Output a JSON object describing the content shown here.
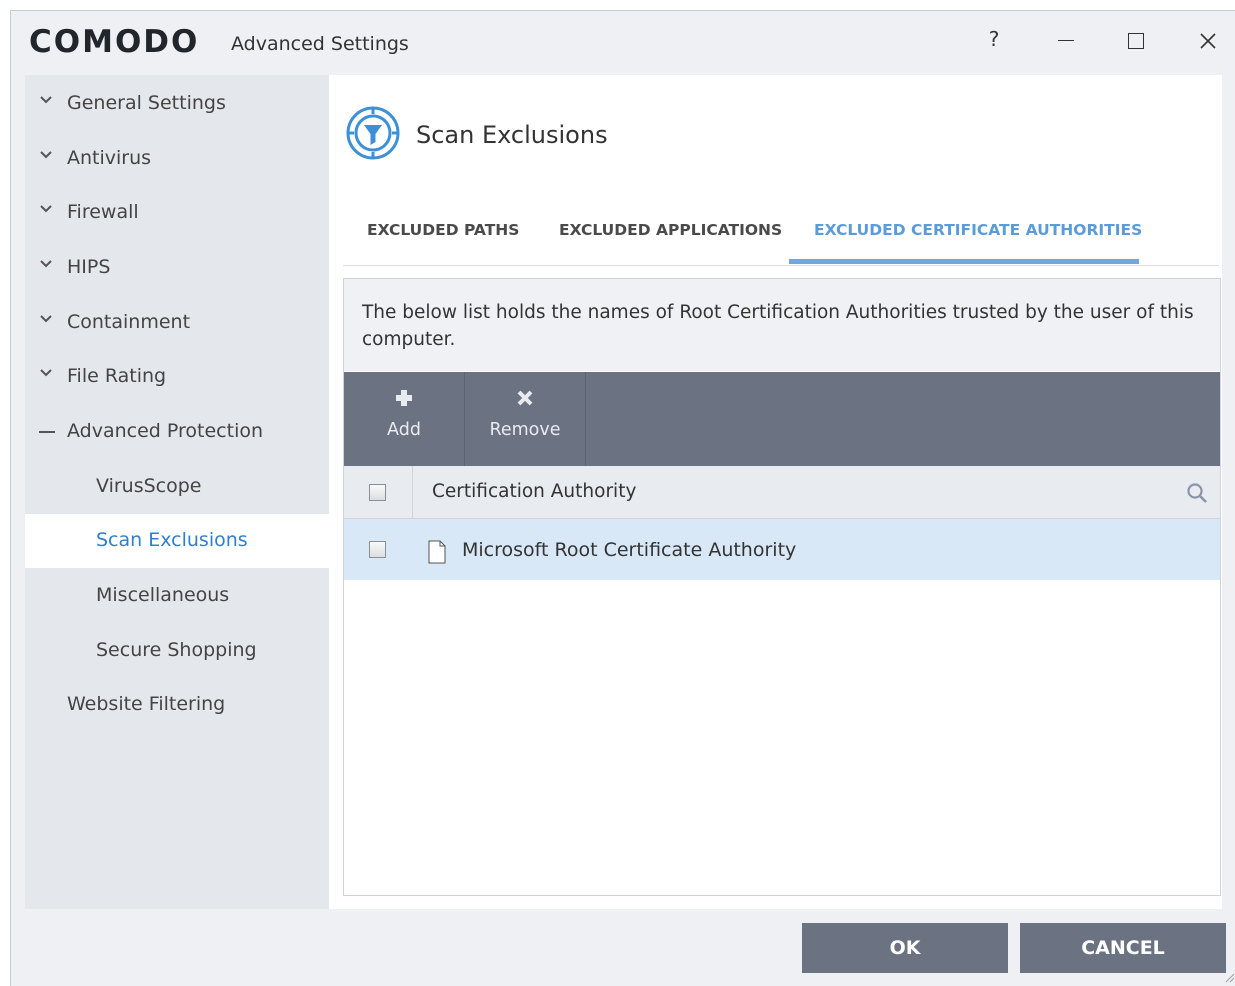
{
  "window": {
    "logo": "COMODO",
    "title": "Advanced Settings",
    "help_label": "?"
  },
  "sidebar": {
    "items": [
      {
        "label": "General Settings",
        "expanded": false
      },
      {
        "label": "Antivirus",
        "expanded": false
      },
      {
        "label": "Firewall",
        "expanded": false
      },
      {
        "label": "HIPS",
        "expanded": false
      },
      {
        "label": "Containment",
        "expanded": false
      },
      {
        "label": "File Rating",
        "expanded": false
      },
      {
        "label": "Advanced Protection",
        "expanded": true,
        "children": [
          {
            "label": "VirusScope"
          },
          {
            "label": "Scan Exclusions",
            "selected": true
          },
          {
            "label": "Miscellaneous"
          },
          {
            "label": "Secure Shopping"
          }
        ]
      },
      {
        "label": "Website Filtering"
      }
    ]
  },
  "main": {
    "section_title": "Scan Exclusions",
    "tabs": [
      {
        "label": "EXCLUDED PATHS",
        "active": false
      },
      {
        "label": "EXCLUDED APPLICATIONS",
        "active": false
      },
      {
        "label": "EXCLUDED CERTIFICATE AUTHORITIES",
        "active": true
      }
    ],
    "description": "The below list holds the names of Root Certification Authorities trusted by the user of this computer.",
    "toolbar": {
      "add_label": "Add",
      "remove_label": "Remove"
    },
    "table": {
      "column_header": "Certification Authority",
      "rows": [
        {
          "name": "Microsoft Root Certificate Authority",
          "checked": false
        }
      ]
    }
  },
  "footer": {
    "ok_label": "OK",
    "cancel_label": "CANCEL"
  },
  "colors": {
    "accent": "#5b9bd9",
    "toolbar_bg": "#6b7383",
    "selected_row": "#d9e8f7",
    "sidebar_bg": "#e4e7ec"
  }
}
